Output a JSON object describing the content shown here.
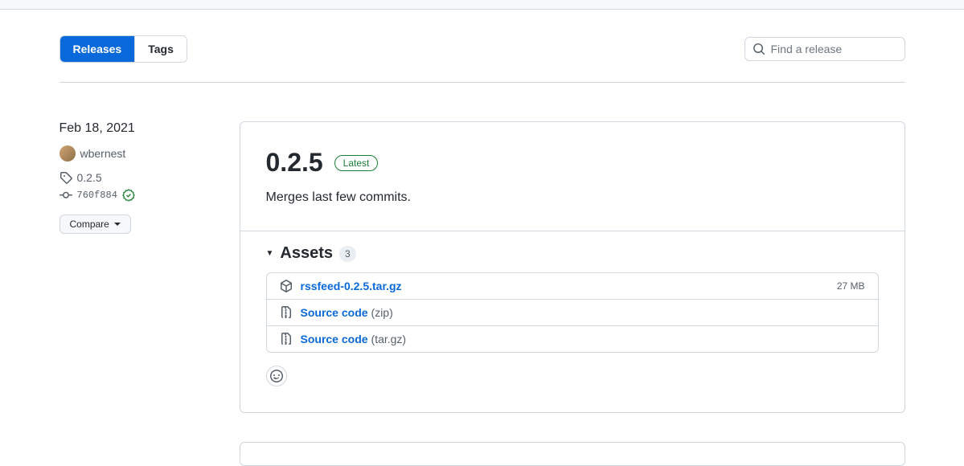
{
  "subnav": {
    "releases_label": "Releases",
    "tags_label": "Tags"
  },
  "search": {
    "placeholder": "Find a release"
  },
  "release": {
    "date": "Feb 18, 2021",
    "author": "wbernest",
    "tag": "0.2.5",
    "commit": "760f884",
    "compare_label": "Compare",
    "title": "0.2.5",
    "latest_label": "Latest",
    "description": "Merges last few commits."
  },
  "assets": {
    "title": "Assets",
    "count": "3",
    "items": [
      {
        "name": "rssfeed-0.2.5.tar.gz",
        "suffix": "",
        "size": "27 MB",
        "icon": "package"
      },
      {
        "name": "Source code",
        "suffix": "(zip)",
        "size": "",
        "icon": "zip"
      },
      {
        "name": "Source code",
        "suffix": "(tar.gz)",
        "size": "",
        "icon": "zip"
      }
    ]
  }
}
